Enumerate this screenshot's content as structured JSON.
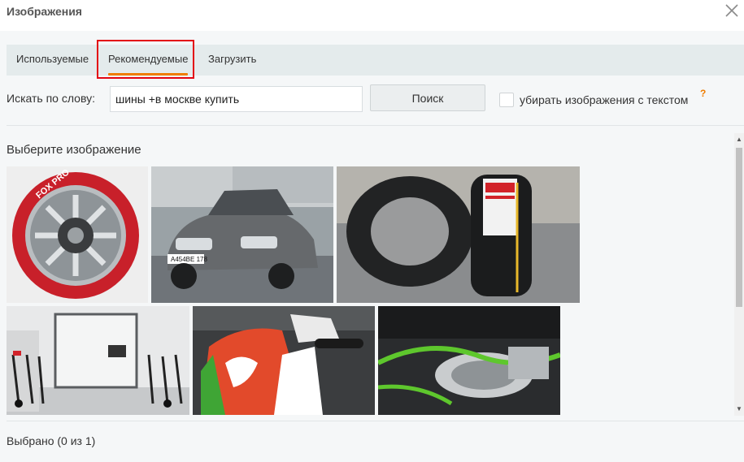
{
  "dialog": {
    "title": "Изображения",
    "close_icon": "close-icon"
  },
  "tabs": [
    {
      "label": "Используемые",
      "active": false
    },
    {
      "label": "Рекомендуемые",
      "active": true
    },
    {
      "label": "Загрузить",
      "active": false
    }
  ],
  "search": {
    "label": "Искать по слову:",
    "value": "шины +в москве купить",
    "button_label": "Поиск",
    "checkbox_label": "убирать изображения с текстом",
    "checkbox_checked": false,
    "help_mark": "?"
  },
  "gallery": {
    "title": "Выберите изображение",
    "images": [
      {
        "name": "scooter-wheel-image",
        "text": "FOX PRO"
      },
      {
        "name": "mercedes-car-image",
        "text": "А454ВЕ 178"
      },
      {
        "name": "tires-image",
        "text": ""
      },
      {
        "name": "scooter-store-image",
        "text": ""
      },
      {
        "name": "motorcycle-fairing-image",
        "text": ""
      },
      {
        "name": "shock-absorber-image",
        "text": ""
      }
    ]
  },
  "footer": {
    "selected_text": "Выбрано (0 из 1)"
  },
  "colors": {
    "accent": "#ef7d00",
    "highlight_box": "#e30613",
    "tab_bar": "#e4ebec"
  }
}
